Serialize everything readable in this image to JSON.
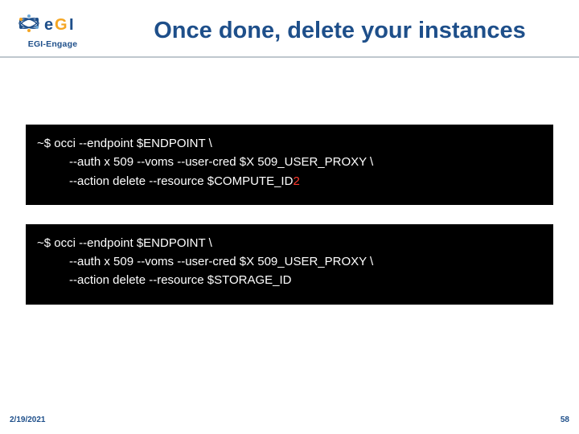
{
  "logo": {
    "sub": "EGI-Engage"
  },
  "title": "Once done, delete your instances",
  "code1": {
    "l1": "~$ occi --endpoint $ENDPOINT \\",
    "l2": "--auth x 509 --voms --user-cred $X 509_USER_PROXY \\",
    "l3a": "--action delete --resource $COMPUTE_ID",
    "l3b": "2"
  },
  "code2": {
    "l1": "~$ occi --endpoint $ENDPOINT \\",
    "l2": "--auth x 509 --voms --user-cred $X 509_USER_PROXY \\",
    "l3": "--action delete --resource $STORAGE_ID"
  },
  "footer": {
    "date": "2/19/2021",
    "page": "58"
  }
}
